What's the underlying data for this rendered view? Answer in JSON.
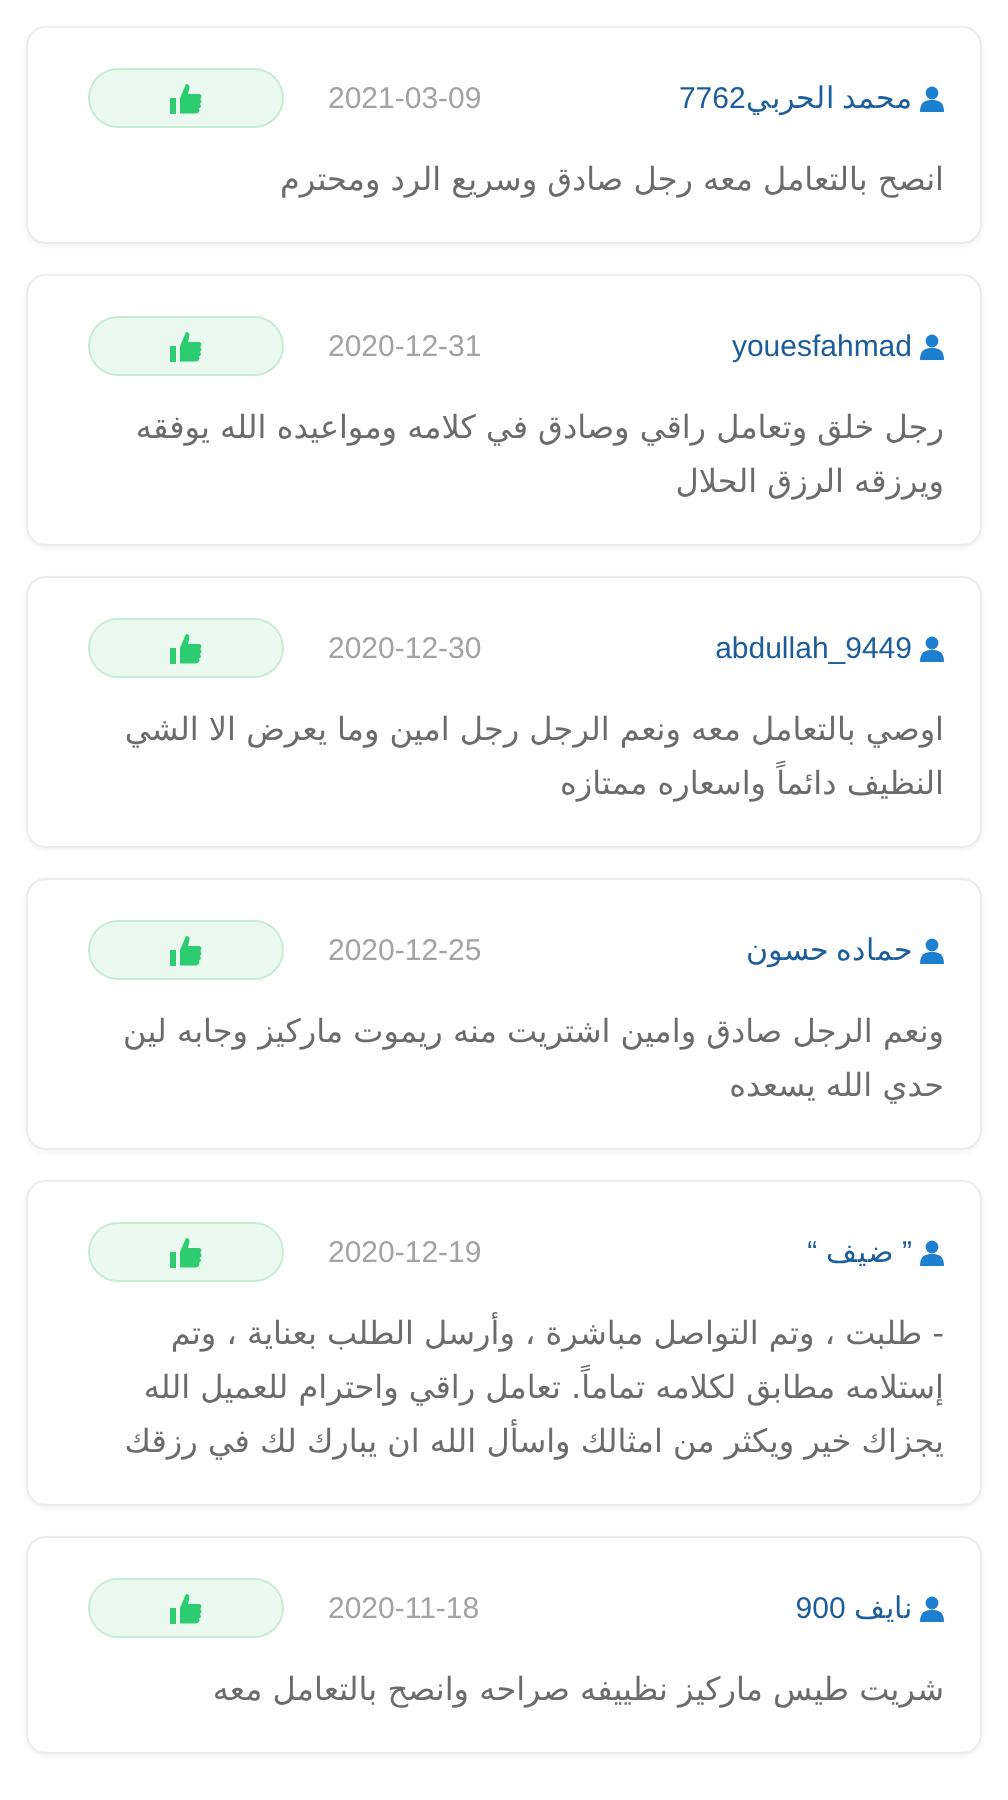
{
  "reviews": [
    {
      "author": "محمد الحربي7762",
      "date": "2021-03-09",
      "text": "انصح بالتعامل معه رجل صادق وسريع الرد ومحترم",
      "liked": true
    },
    {
      "author": "youesfahmad",
      "date": "2020-12-31",
      "text": "رجل خلق وتعامل راقي وصادق في كلامه ومواعيده الله يوفقه ويرزقه الرزق الحلال",
      "liked": true
    },
    {
      "author": "abdullah_9449",
      "date": "2020-12-30",
      "text": "اوصي بالتعامل معه ونعم الرجل رجل امين وما يعرض الا الشي النظيف دائماً واسعاره ممتازه",
      "liked": true
    },
    {
      "author": "حماده حسون",
      "date": "2020-12-25",
      "text": "ونعم الرجل صادق وامين اشتريت منه ريموت ماركيز وجابه لين حدي الله يسعده",
      "liked": true
    },
    {
      "author": "” ضيف “",
      "date": "2020-12-19",
      "text": "- طلبت ، وتم التواصل مباشرة ، وأرسل الطلب بعناية ، وتم إستلامه مطابق لكلامه تماماً. تعامل راقي واحترام للعميل الله يجزاك خير ويكثر من امثالك واسأل الله ان يبارك لك في رزقك",
      "liked": true
    },
    {
      "author": "نايف 900",
      "date": "2020-11-18",
      "text": "شريت طيس ماركيز نظييفه صراحه وانصح بالتعامل معه",
      "liked": true
    }
  ]
}
